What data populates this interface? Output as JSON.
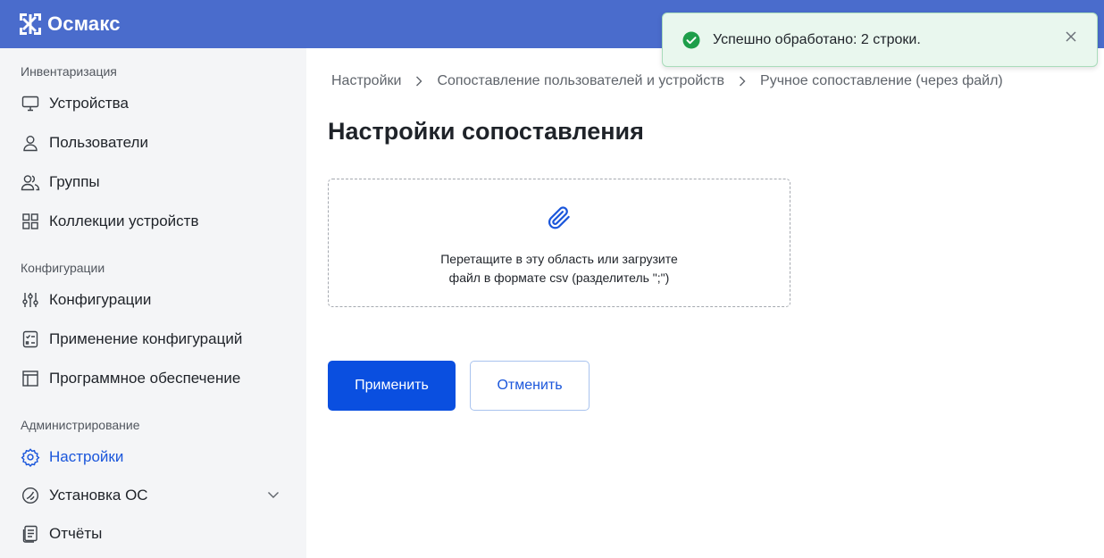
{
  "app": {
    "name": "Осмакс",
    "brand_color": "#4a6ccc",
    "accent_color": "#1a56db"
  },
  "sidebar": {
    "sections": [
      {
        "title": "Инвентаризация",
        "items": [
          {
            "label": "Устройства",
            "icon": "monitor-icon"
          },
          {
            "label": "Пользователи",
            "icon": "user-icon"
          },
          {
            "label": "Группы",
            "icon": "users-group-icon"
          },
          {
            "label": "Коллекции устройств",
            "icon": "grid-icon"
          }
        ]
      },
      {
        "title": "Конфигурации",
        "items": [
          {
            "label": "Конфигурации",
            "icon": "sliders-icon"
          },
          {
            "label": "Применение конфигураций",
            "icon": "checklist-icon"
          },
          {
            "label": "Программное обеспечение",
            "icon": "layout-icon"
          }
        ]
      },
      {
        "title": "Администрирование",
        "items": [
          {
            "label": "Настройки",
            "icon": "gear-icon",
            "active": true
          },
          {
            "label": "Установка ОС",
            "icon": "os-install-icon",
            "expandable": true
          },
          {
            "label": "Отчёты",
            "icon": "report-icon"
          }
        ]
      }
    ]
  },
  "breadcrumb": [
    "Настройки",
    "Сопоставление пользователей и устройств",
    "Ручное сопоставление (через файл)"
  ],
  "page": {
    "title": "Настройки сопоставления"
  },
  "dropzone": {
    "icon": "paperclip-icon",
    "line1": "Перетащите в эту область или загрузите",
    "line2": "файл в формате csv (разделитель \";\")"
  },
  "actions": {
    "apply": "Применить",
    "cancel": "Отменить"
  },
  "toast": {
    "status": "success",
    "message": "Успешно обработано: 2 строки.",
    "color": "#1e9e4a"
  }
}
